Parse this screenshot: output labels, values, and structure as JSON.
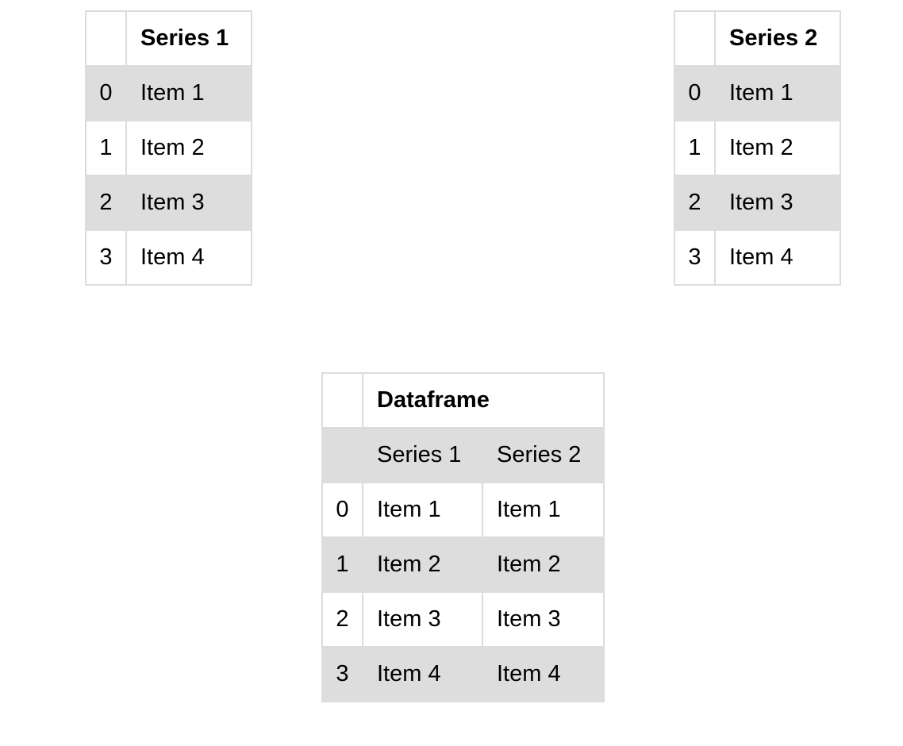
{
  "series1": {
    "title": "Series 1",
    "rows": [
      {
        "index": "0",
        "value": "Item 1"
      },
      {
        "index": "1",
        "value": "Item 2"
      },
      {
        "index": "2",
        "value": "Item 3"
      },
      {
        "index": "3",
        "value": "Item 4"
      }
    ]
  },
  "series2": {
    "title": "Series 2",
    "rows": [
      {
        "index": "0",
        "value": "Item 1"
      },
      {
        "index": "1",
        "value": "Item 2"
      },
      {
        "index": "2",
        "value": "Item 3"
      },
      {
        "index": "3",
        "value": "Item 4"
      }
    ]
  },
  "dataframe": {
    "title": "Dataframe",
    "columns": [
      "Series 1",
      "Series 2"
    ],
    "rows": [
      {
        "index": "0",
        "values": [
          "Item 1",
          "Item 1"
        ]
      },
      {
        "index": "1",
        "values": [
          "Item 2",
          "Item 2"
        ]
      },
      {
        "index": "2",
        "values": [
          "Item 3",
          "Item 3"
        ]
      },
      {
        "index": "3",
        "values": [
          "Item 4",
          "Item 4"
        ]
      }
    ]
  },
  "colors": {
    "shade": "#dddddd",
    "border": "#dcdcdc",
    "text": "#000000"
  }
}
